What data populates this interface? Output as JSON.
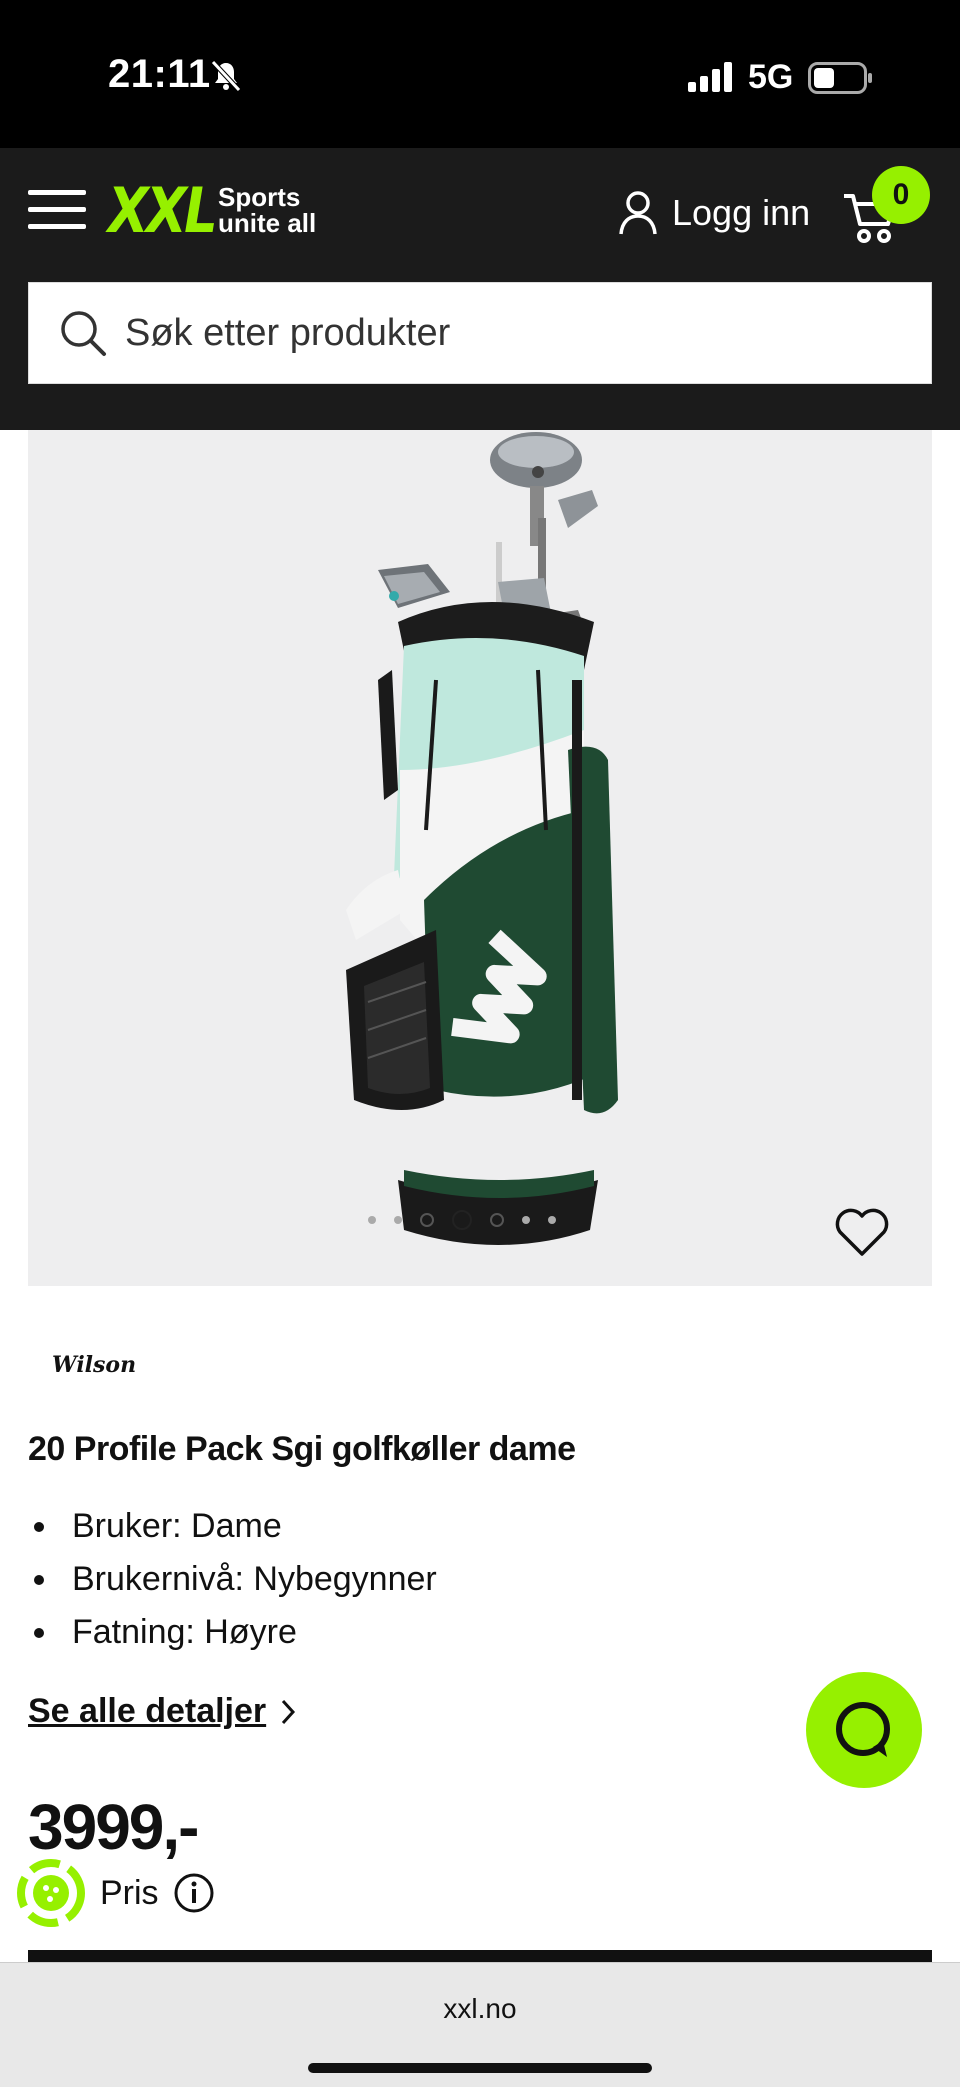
{
  "status": {
    "time": "21:11",
    "network": "5G"
  },
  "header": {
    "logo_text": "XXL",
    "logo_tagline": "Sports\nunite all",
    "login_label": "Logg inn",
    "cart_count": "0"
  },
  "search": {
    "placeholder": "Søk etter produkter"
  },
  "product": {
    "brand": "Wilson",
    "title": "20 Profile Pack Sgi golfkøller dame",
    "specs": [
      "Bruker: Dame",
      "Brukernivå: Nybegynner",
      "Fatning: Høyre"
    ],
    "details_link": "Se alle detaljer",
    "price": "3999,-",
    "price_label": "Pris",
    "gallery": {
      "image_count": 7,
      "active_index": 3
    }
  },
  "browser": {
    "url": "xxl.no"
  },
  "colors": {
    "accent": "#96f000",
    "header_bg": "#1b1b1b",
    "bag_green": "#1f4a32",
    "bag_mint": "#bfe8dd"
  }
}
